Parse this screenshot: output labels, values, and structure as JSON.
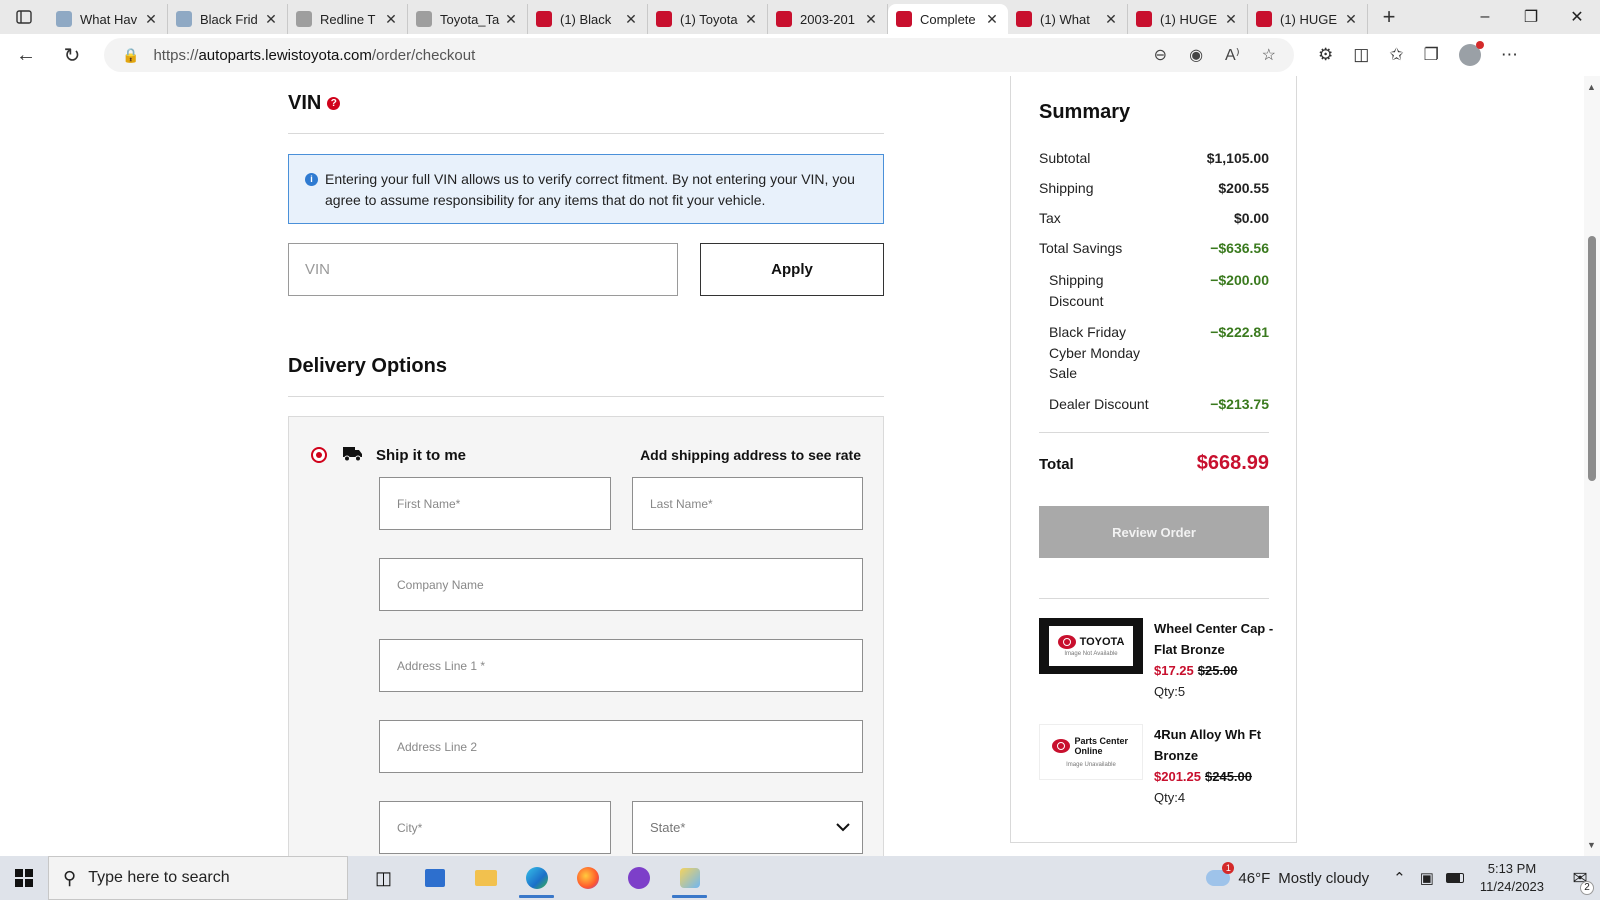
{
  "browser": {
    "tabs": [
      {
        "title": "What Hav",
        "color": "#8fa9c4"
      },
      {
        "title": "Black Frid",
        "color": "#8fa9c4"
      },
      {
        "title": "Redline T",
        "color": "#9e9e9e"
      },
      {
        "title": "Toyota_Ta",
        "color": "#9e9e9e"
      },
      {
        "title": "(1) Black",
        "color": "#c8102e"
      },
      {
        "title": "(1) Toyota",
        "color": "#c8102e"
      },
      {
        "title": "2003-201",
        "color": "#c8102e"
      },
      {
        "title": "Complete",
        "color": "#c8102e",
        "active": true
      },
      {
        "title": "(1) What",
        "color": "#c8102e"
      },
      {
        "title": "(1) HUGE",
        "color": "#c8102e"
      },
      {
        "title": "(1) HUGE",
        "color": "#c8102e"
      }
    ],
    "url_prefix": "https://",
    "url_host": "autoparts.lewistoyota.com",
    "url_path": "/order/checkout"
  },
  "vin": {
    "title": "VIN",
    "info": "Entering your full VIN allows us to verify correct fitment. By not entering your VIN, you agree to assume responsibility for any items that do not fit your vehicle.",
    "placeholder": "VIN",
    "apply_label": "Apply"
  },
  "delivery": {
    "title": "Delivery Options",
    "ship_label": "Ship it to me",
    "rate_text": "Add shipping address to see rate",
    "fields": {
      "first_name": "First Name*",
      "last_name": "Last Name*",
      "company": "Company Name",
      "address1": "Address Line 1 *",
      "address2": "Address Line 2",
      "city": "City*",
      "state": "State*"
    }
  },
  "summary": {
    "title": "Summary",
    "subtotal_label": "Subtotal",
    "subtotal": "$1,105.00",
    "shipping_label": "Shipping",
    "shipping": "$200.55",
    "tax_label": "Tax",
    "tax": "$0.00",
    "savings_label": "Total Savings",
    "savings": "−$636.56",
    "discounts": [
      {
        "label": "Shipping Discount",
        "value": "−$200.00"
      },
      {
        "label": "Black Friday Cyber Monday Sale",
        "value": "−$222.81"
      },
      {
        "label": "Dealer Discount",
        "value": "−$213.75"
      }
    ],
    "total_label": "Total",
    "total": "$668.99",
    "review_label": "Review Order",
    "items": [
      {
        "name": "Wheel Center Cap - Flat Bronze",
        "price": "$17.25",
        "original": "$25.00",
        "qty": "Qty:5",
        "thumb_brand": "TOYOTA",
        "thumb_note": "Image Not Available"
      },
      {
        "name": "4Run Alloy Wh Ft Bronze",
        "price": "$201.25",
        "original": "$245.00",
        "qty": "Qty:4",
        "thumb_brand": "Parts Center Online",
        "thumb_note": "Image Unavailable"
      }
    ]
  },
  "taskbar": {
    "search_placeholder": "Type here to search",
    "weather_temp": "46°F",
    "weather_desc": "Mostly cloudy",
    "time": "5:13 PM",
    "date": "11/24/2023",
    "notification_count": "2",
    "weather_badge": "1"
  }
}
